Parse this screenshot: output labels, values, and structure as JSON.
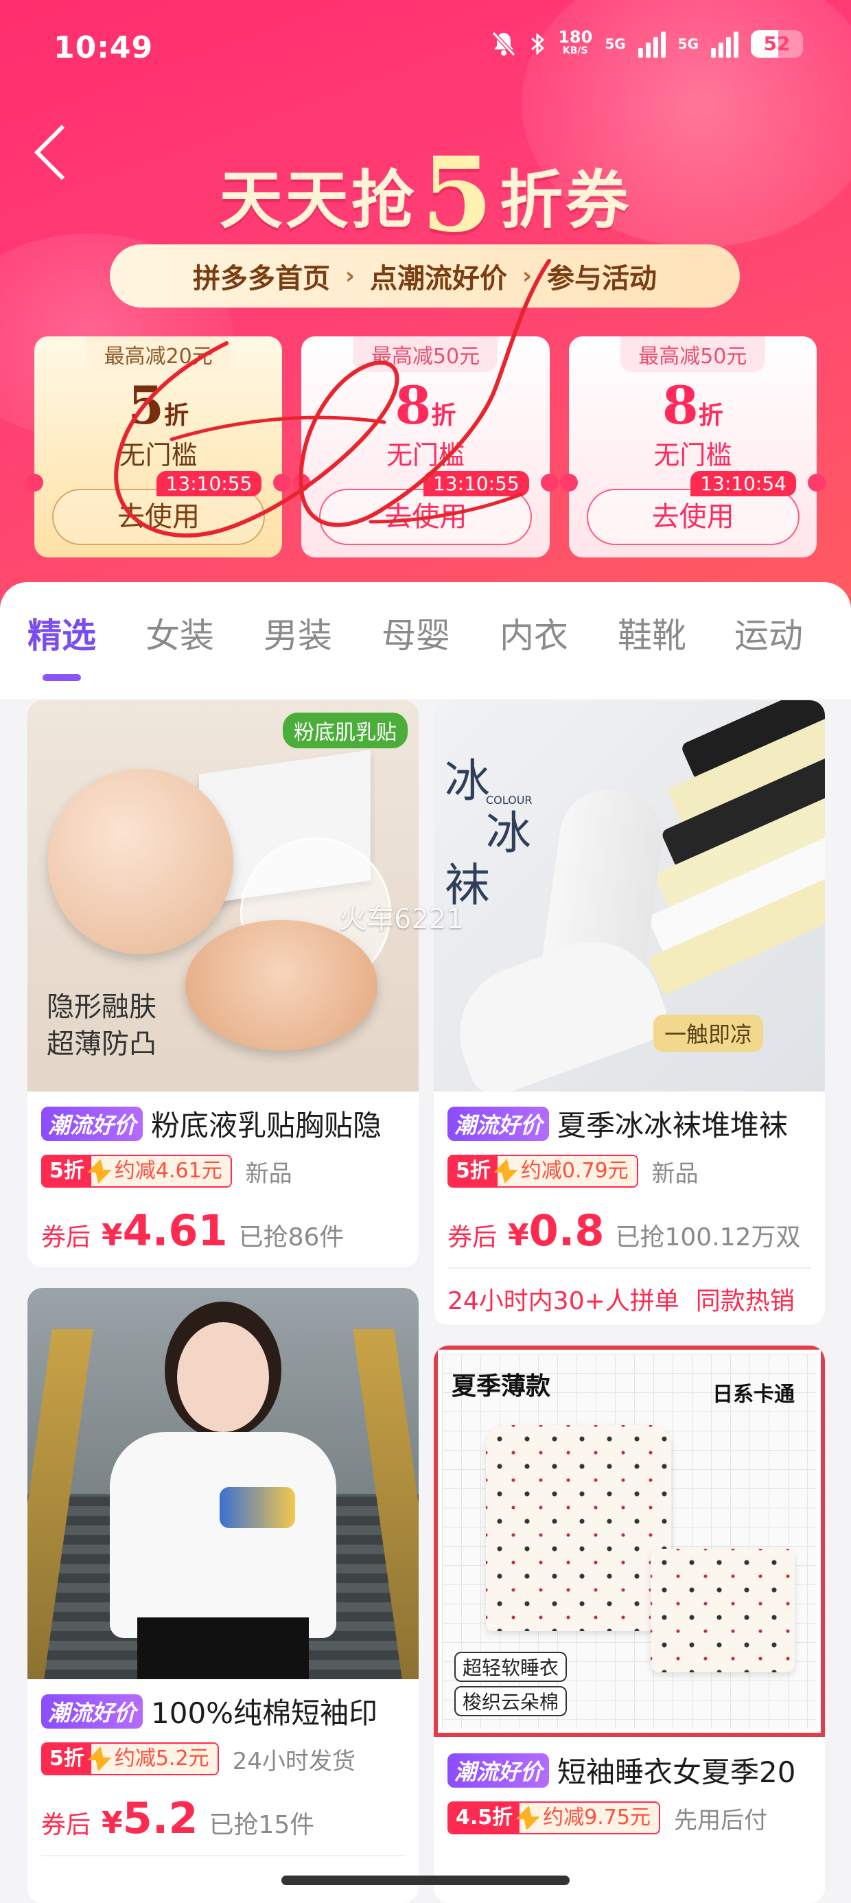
{
  "status_bar": {
    "time": "10:49",
    "net_speed_top": "180",
    "net_speed_unit": "KB/S",
    "sim1": "5G",
    "sim2": "5G",
    "battery": "52"
  },
  "header": {
    "title_prefix": "天天抢",
    "title_number": "5",
    "title_suffix": "折券",
    "steps": [
      "拼多多首页",
      "点潮流好价",
      "参与活动"
    ]
  },
  "coupons": [
    {
      "cap": "最高减20元",
      "discount_num": "5",
      "discount_unit": "折",
      "condition": "无门槛",
      "timer": "13:10:55",
      "button": "去使用",
      "style": "gold"
    },
    {
      "cap": "最高减50元",
      "discount_num": "8",
      "discount_unit": "折",
      "condition": "无门槛",
      "timer": "13:10:55",
      "button": "去使用",
      "style": "pink"
    },
    {
      "cap": "最高减50元",
      "discount_num": "8",
      "discount_unit": "折",
      "condition": "无门槛",
      "timer": "13:10:54",
      "button": "去使用",
      "style": "pink"
    }
  ],
  "tabs": [
    "精选",
    "女装",
    "男装",
    "母婴",
    "内衣",
    "鞋靴",
    "运动"
  ],
  "active_tab": "精选",
  "products": [
    {
      "image_tag": "粉底肌乳贴",
      "image_text_1": "隐形融肤",
      "image_text_2": "超薄防凸",
      "badge": "潮流好价",
      "title": "粉底液乳贴胸贴隐",
      "discount": "5折",
      "save": "约减4.61元",
      "extra": "新品",
      "price_label": "券后",
      "currency": "¥",
      "price": "4.61",
      "sold": "已抢86件"
    },
    {
      "image_text_1": "冰",
      "image_text_2": "冰",
      "image_text_3": "袜",
      "image_text_4": "COLOUR",
      "image_text_5": "一触即凉",
      "badge": "潮流好价",
      "title": "夏季冰冰袜堆堆袜",
      "discount": "5折",
      "save": "约减0.79元",
      "extra": "新品",
      "price_label": "券后",
      "currency": "¥",
      "price": "0.8",
      "sold": "已抢100.12万双",
      "hot": "24小时内30+人拼单",
      "hot2": "同款热销"
    },
    {
      "badge": "潮流好价",
      "title": "100%纯棉短袖印",
      "discount": "5折",
      "save": "约减5.2元",
      "extra": "24小时发货",
      "price_label": "券后",
      "currency": "¥",
      "price": "5.2",
      "sold": "已抢15件"
    },
    {
      "image_text_1": "夏季薄款",
      "image_text_2": "日系卡通",
      "image_text_3": "超轻软睡衣",
      "image_text_4": "梭织云朵棉",
      "badge": "潮流好价",
      "title": "短袖睡衣女夏季20",
      "discount": "4.5折",
      "save": "约减9.75元",
      "extra": "先用后付"
    }
  ],
  "watermark": "火车6221",
  "colors": {
    "brand_pink": "#ff2e6e",
    "accent_purple": "#7a4df0",
    "price_red": "#ff2a4f"
  }
}
